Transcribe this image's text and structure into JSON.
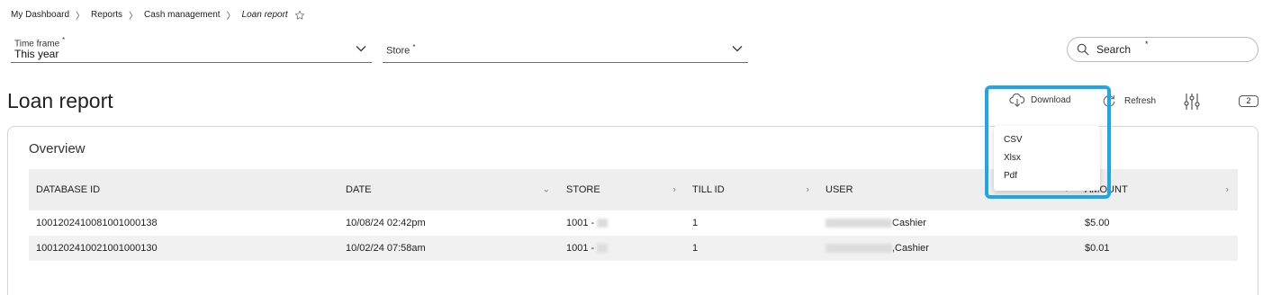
{
  "breadcrumb": {
    "items": [
      "My Dashboard",
      "Reports",
      "Cash management"
    ],
    "current": "Loan report",
    "separator": "〉"
  },
  "filters": {
    "timeframe": {
      "label": "Time frame",
      "required_mark": "*",
      "value": "This year"
    },
    "store": {
      "label": "Store",
      "required_mark": "*",
      "value": ""
    },
    "search": {
      "placeholder": "Search",
      "required_mark": "*"
    }
  },
  "page": {
    "title": "Loan report"
  },
  "actions": {
    "download_label": "Download",
    "refresh_label": "Refresh",
    "filter_count": "2",
    "download_menu": [
      "CSV",
      "Xlsx",
      "Pdf"
    ]
  },
  "overview": {
    "title": "Overview",
    "columns": [
      "DATABASE ID",
      "DATE",
      "STORE",
      "TILL ID",
      "USER",
      "AMOUNT"
    ],
    "rows": [
      {
        "database_id": "1001202410081001000138",
        "date": "10/08/24 02:42pm",
        "store": "1001 -",
        "till_id": "1",
        "user": "Cashier",
        "amount": "$5.00"
      },
      {
        "database_id": "1001202410021001000130",
        "date": "10/02/24 07:58am",
        "store": "1001 -",
        "till_id": "1",
        "user": ",Cashier",
        "amount": "$0.01"
      }
    ]
  },
  "colors": {
    "highlight": "#1ea7e8",
    "header_bg": "#eeeeee",
    "row_alt_bg": "#f1f1f1"
  },
  "icons": {
    "breadcrumb": "star-icon",
    "search": "search-icon",
    "download": "cloud-download-icon",
    "refresh": "refresh-icon",
    "filters": "sliders-icon",
    "dropdown": "chevron-down-icon"
  }
}
